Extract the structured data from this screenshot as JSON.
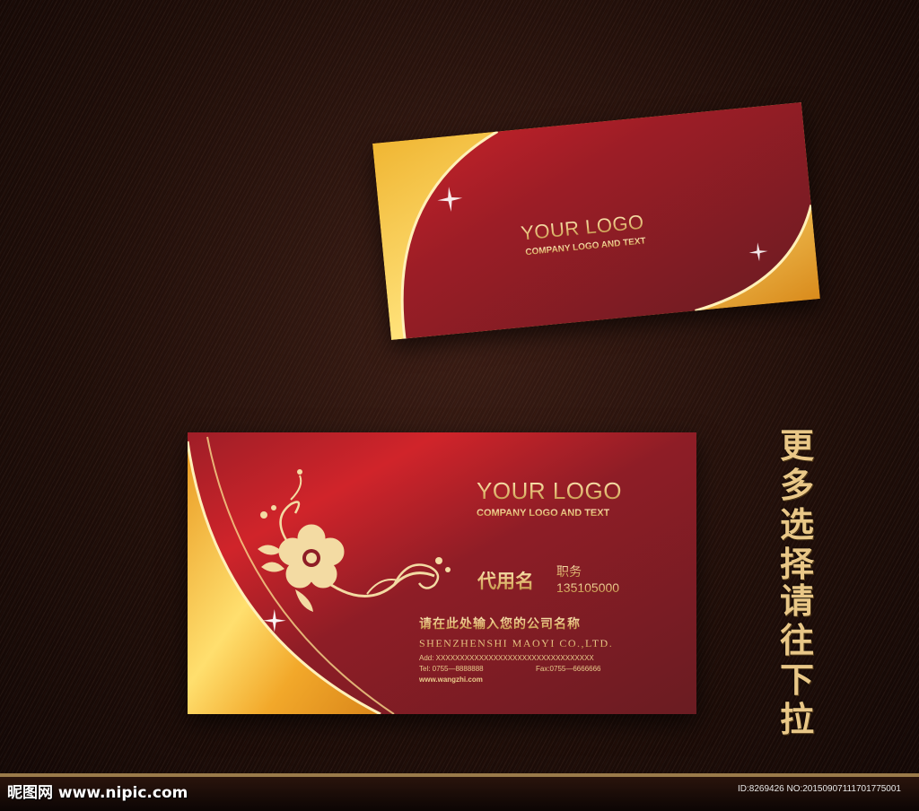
{
  "card_back": {
    "logo_title": "YOUR LOGO",
    "logo_subtitle": "COMPANY LOGO AND TEXT"
  },
  "card_front": {
    "logo_title": "YOUR LOGO",
    "logo_subtitle": "COMPANY LOGO AND TEXT",
    "name": "代用名",
    "title": "职务",
    "phone": "135105000",
    "company_cn": "请在此处输入您的公司名称",
    "company_en": "SHENZHENSHI MAOYI  CO.,LTD.",
    "address": "Add: XXXXXXXXXXXXXXXXXXXXXXXXXXXXXXXXX",
    "tel": "Tel: 0755—8888888",
    "fax": "Fax:0755—6666666",
    "website": "www.wangzhi.com"
  },
  "slogan": {
    "line1": "更多选择",
    "line2": "请往下拉"
  },
  "watermark": {
    "left": "昵图网 www.nipic.com",
    "right": "ID:8269426 NO:20150907111701775001"
  },
  "colors": {
    "card_red": "#9a1f24",
    "card_dark": "#6e1c22",
    "gold": "#e6b040",
    "gold_light": "#fbd46a"
  },
  "icons": {
    "flower": "flower-ornament-icon",
    "sparkle": "sparkle-icon"
  }
}
